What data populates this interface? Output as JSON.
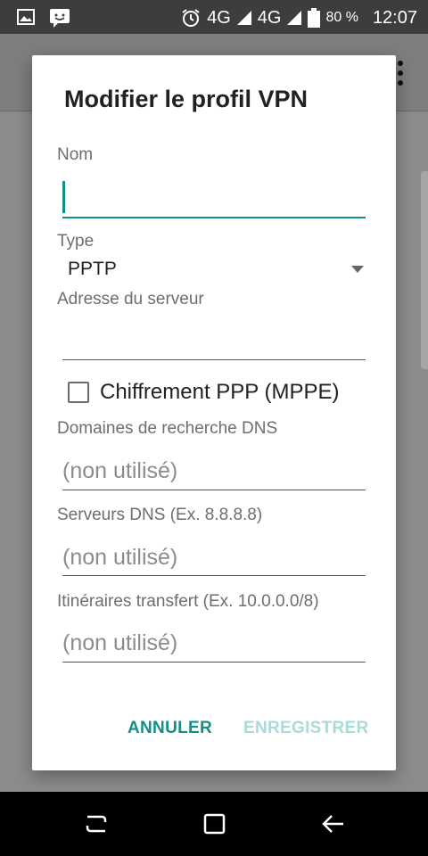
{
  "status_bar": {
    "network1": "4G",
    "network2": "4G",
    "battery_percent": "80 %",
    "time": "12:07",
    "icons": [
      "image-icon",
      "message-icon",
      "alarm-icon",
      "signal-icon",
      "battery-icon"
    ]
  },
  "dialog": {
    "title": "Modifier le profil VPN",
    "name_label": "Nom",
    "name_value": "",
    "type_label": "Type",
    "type_value": "PPTP",
    "server_label": "Adresse du serveur",
    "server_value": "",
    "encryption_label": "Chiffrement PPP (MPPE)",
    "encryption_checked": false,
    "dns_search_label": "Domaines de recherche DNS",
    "dns_search_placeholder": "(non utilisé)",
    "dns_servers_label": "Serveurs DNS (Ex. 8.8.8.8)",
    "dns_servers_placeholder": "(non utilisé)",
    "routes_label": "Itinéraires transfert (Ex. 10.0.0.0/8)",
    "routes_placeholder": "(non utilisé)",
    "cancel_button": "ANNULER",
    "save_button": "ENREGISTRER"
  },
  "colors": {
    "accent": "#128f86",
    "disabled_accent": "#a9dcd6",
    "status_bar": "#3d3d3d",
    "scrim": "#8c8c8c"
  }
}
